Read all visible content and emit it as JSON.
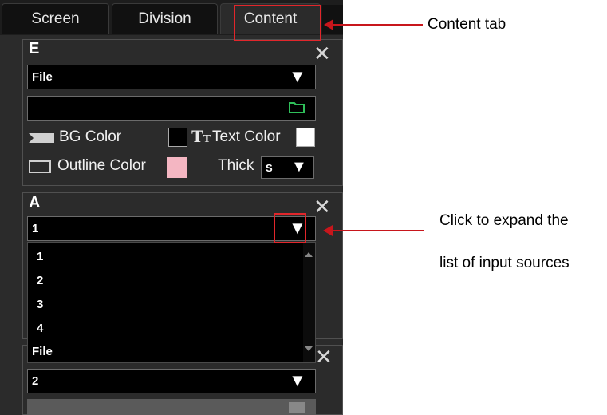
{
  "tabs": [
    {
      "label": "Screen"
    },
    {
      "label": "Division"
    },
    {
      "label": "Content"
    }
  ],
  "section_e": {
    "letter": "E",
    "source_value": "File",
    "path_value": "",
    "bg_color_label": "BG Color",
    "text_color_label": "Text Color",
    "outline_color_label": "Outline Color",
    "thick_label": "Thick",
    "thick_value": "S",
    "text_icon": "TT",
    "colors": {
      "bg": "#000000",
      "text": "#ffffff",
      "outline": "#f4b6c2"
    }
  },
  "section_a": {
    "letter": "A",
    "source_value": "1",
    "options": [
      "1",
      "2",
      "3",
      "4",
      "File"
    ]
  },
  "section_third": {
    "source_value": "2"
  },
  "close_glyph": "✕",
  "dropdown_glyph": "▼",
  "annotations": {
    "content_tab": "Content tab",
    "expand_line1": "Click to expand the",
    "expand_line2": "list of input sources"
  },
  "colors": {
    "accent_red": "#e1262b",
    "folder_green": "#2fbf5a"
  }
}
